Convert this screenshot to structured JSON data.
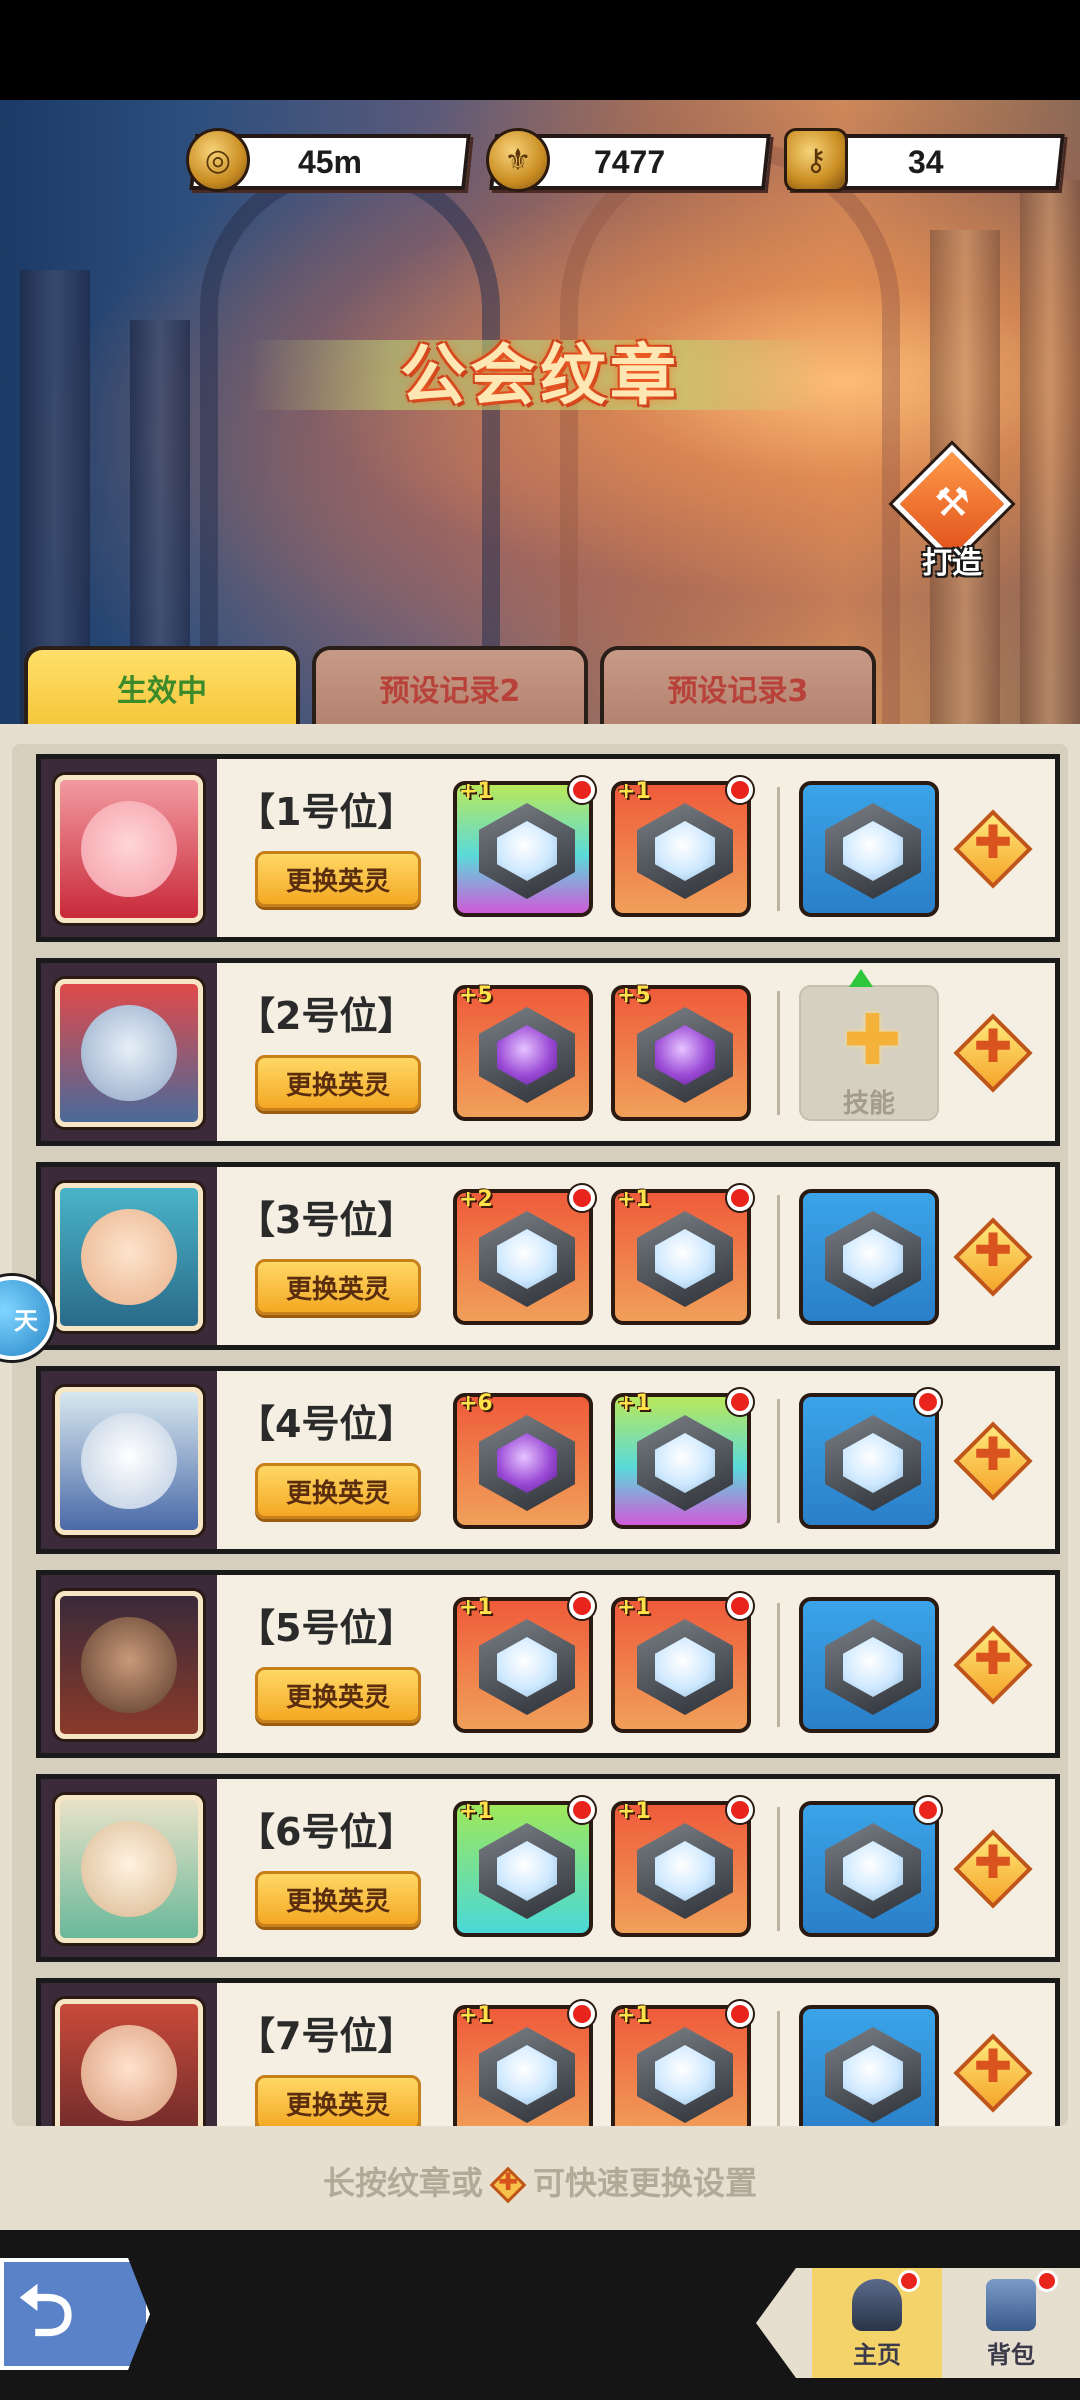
{
  "resources": [
    {
      "icon": "coin-icon",
      "value": "45m"
    },
    {
      "icon": "guild-coin-icon",
      "value": "7477"
    },
    {
      "icon": "key-icon",
      "value": "34"
    }
  ],
  "page_title": "公会纹章",
  "forge_label": "打造",
  "tabs": [
    {
      "label": "生效中",
      "active": true
    },
    {
      "label": "预设记录2",
      "active": false
    },
    {
      "label": "预设记录3",
      "active": false
    }
  ],
  "slots": [
    {
      "label": "【1号位】",
      "swap_label": "更换英灵",
      "emblems": [
        {
          "lvl": "+1",
          "bg": "rainbow",
          "dot": true
        },
        {
          "lvl": "+1",
          "bg": "orange",
          "dot": true
        }
      ],
      "skill": "blue"
    },
    {
      "label": "【2号位】",
      "swap_label": "更换英灵",
      "emblems": [
        {
          "lvl": "+5",
          "bg": "orange",
          "purple": true
        },
        {
          "lvl": "+5",
          "bg": "orange",
          "purple": true
        }
      ],
      "skill": "empty",
      "skill_label": "技能"
    },
    {
      "label": "【3号位】",
      "swap_label": "更换英灵",
      "emblems": [
        {
          "lvl": "+2",
          "bg": "orange",
          "dot": true
        },
        {
          "lvl": "+1",
          "bg": "orange",
          "dot": true
        }
      ],
      "skill": "blue"
    },
    {
      "label": "【4号位】",
      "swap_label": "更换英灵",
      "emblems": [
        {
          "lvl": "+6",
          "bg": "orange",
          "purple": true
        },
        {
          "lvl": "+1",
          "bg": "rainbow",
          "dot": true
        }
      ],
      "skill": "blue-dot"
    },
    {
      "label": "【5号位】",
      "swap_label": "更换英灵",
      "emblems": [
        {
          "lvl": "+1",
          "bg": "orange",
          "dot": true
        },
        {
          "lvl": "+1",
          "bg": "orange",
          "dot": true
        }
      ],
      "skill": "blue"
    },
    {
      "label": "【6号位】",
      "swap_label": "更换英灵",
      "emblems": [
        {
          "lvl": "+1",
          "bg": "green",
          "dot": true
        },
        {
          "lvl": "+1",
          "bg": "orange",
          "dot": true
        }
      ],
      "skill": "blue-dot"
    },
    {
      "label": "【7号位】",
      "swap_label": "更换英灵",
      "emblems": [
        {
          "lvl": "+1",
          "bg": "orange",
          "dot": true
        },
        {
          "lvl": "+1",
          "bg": "orange",
          "dot": true
        }
      ],
      "skill": "blue"
    }
  ],
  "hint": {
    "before": "长按纹章或",
    "after": "可快速更换设置"
  },
  "side_badge": "天",
  "nav": [
    {
      "label": "主页",
      "icon": "helmet-icon",
      "active": true
    },
    {
      "label": "背包",
      "icon": "backpack-icon",
      "active": false
    }
  ],
  "colors": {
    "accent_yellow": "#f5c63a",
    "tab_inactive_text": "#b8423a",
    "active_tab_text": "#3c8a2a",
    "badge_red": "#e8241c"
  }
}
